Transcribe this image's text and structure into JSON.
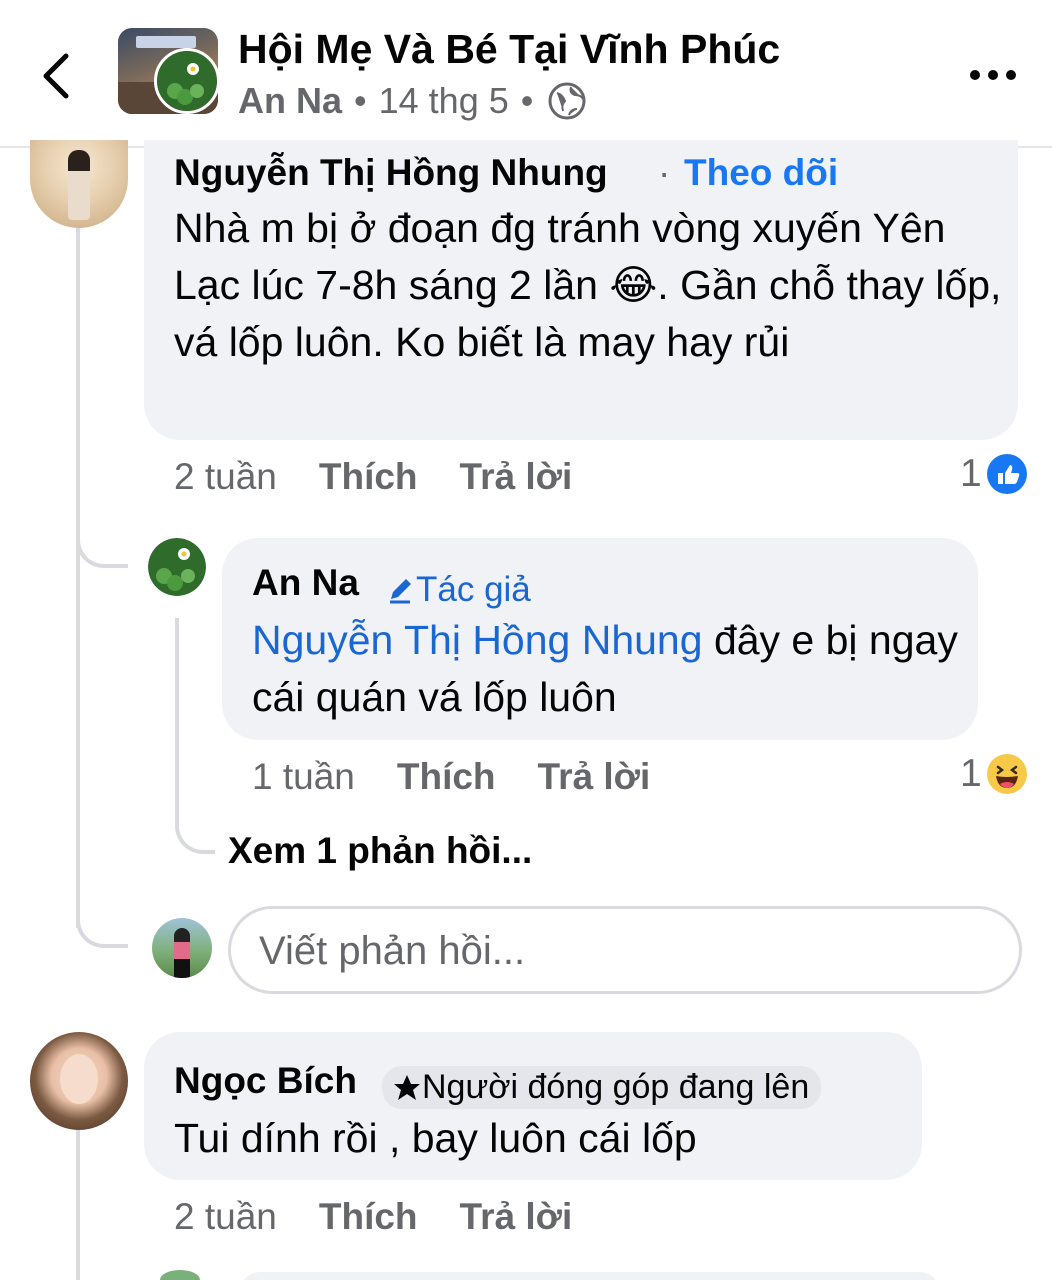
{
  "header": {
    "title": "Hội Mẹ Và Bé Tại Vĩnh Phúc",
    "author": "An Na",
    "sep1": "•",
    "date": "14 thg 5",
    "sep2": "•",
    "back_icon": "chevron-left-icon",
    "privacy_icon": "globe-icon",
    "more_icon": "more-horizontal-icon"
  },
  "comments": [
    {
      "author": "Nguyễn Thị Hồng Nhung",
      "separator": "·",
      "follow_label": "Theo dõi",
      "text_before_emoji": "Nhà m bị ở đoạn đg tránh vòng xuyến Yên Lạc lúc 7-8h sáng 2 lần ",
      "emoji": "😂",
      "text_after_emoji": ". Gần chỗ thay lốp, vá lốp luôn. Ko biết là may hay rủi",
      "time": "2 tuần",
      "like_label": "Thích",
      "reply_label": "Trả lời",
      "reaction_count": "1",
      "reaction_icon": "like-icon"
    },
    {
      "author": "An Na",
      "badge": "Tác giả",
      "badge_icon": "pencil-icon",
      "mention": "Nguyễn Thị Hồng Nhung",
      "text": " đây e bị ngay cái quán vá lốp luôn",
      "time": "1 tuần",
      "like_label": "Thích",
      "reply_label": "Trả lời",
      "reaction_count": "1",
      "reaction_icon": "haha-icon"
    },
    {
      "author": "Ngọc Bích",
      "badge": "Người đóng góp đang lên",
      "badge_icon": "star-icon",
      "text": "Tui dính rồi , bay luôn cái lốp",
      "time": "2 tuần",
      "like_label": "Thích",
      "reply_label": "Trả lời"
    }
  ],
  "more_replies": "Xem 1 phản hồi...",
  "reply_input": {
    "placeholder": "Viết phản hồi..."
  },
  "colors": {
    "accent": "#1877f2",
    "mention": "#1a66d2",
    "bubble": "#f0f2f5",
    "secondary_text": "#65676b"
  }
}
